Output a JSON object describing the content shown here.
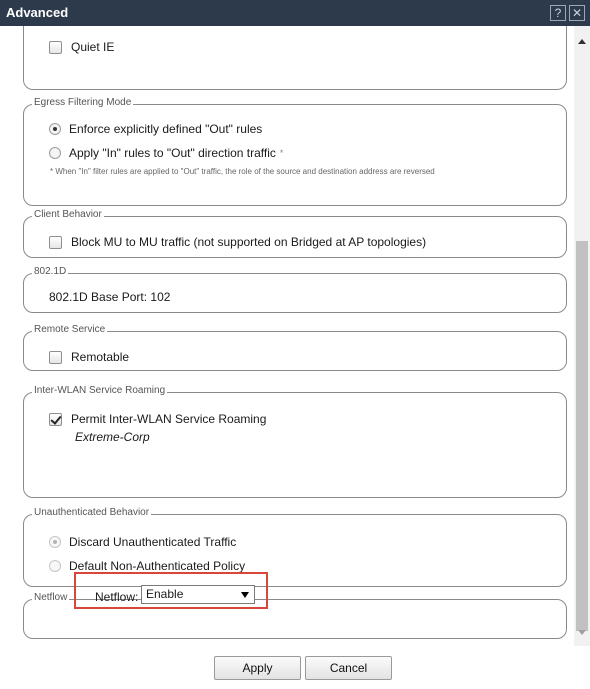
{
  "window": {
    "title": "Advanced",
    "help_glyph": "?",
    "close_glyph": "✕"
  },
  "quiet_ie": {
    "label": "Quiet IE",
    "checked": false
  },
  "egress": {
    "legend": "Egress Filtering Mode",
    "option1": "Enforce explicitly defined \"Out\" rules",
    "option2": "Apply \"In\" rules to \"Out\" direction traffic",
    "asterisk": "*",
    "note": "* When \"In\" filter rules are applied to \"Out\" traffic, the role of the source and destination address are reversed",
    "selected": 1
  },
  "client": {
    "legend": "Client Behavior",
    "label": "Block MU to MU traffic (not supported on Bridged at AP topologies)",
    "checked": false
  },
  "dot1d": {
    "legend": "802.1D",
    "text": "802.1D Base Port: 102"
  },
  "remote": {
    "legend": "Remote Service",
    "label": "Remotable",
    "checked": false
  },
  "roaming": {
    "legend": "Inter-WLAN Service Roaming",
    "label": "Permit Inter-WLAN Service Roaming",
    "checked": true,
    "service": "Extreme-Corp"
  },
  "unauth": {
    "legend": "Unauthenticated Behavior",
    "option1": "Discard Unauthenticated Traffic",
    "option2": "Default Non-Authenticated Policy",
    "selected": 1
  },
  "netflow": {
    "legend": "Netflow",
    "label": "Netflow:",
    "value": "Enable"
  },
  "buttons": {
    "apply": "Apply",
    "cancel": "Cancel"
  },
  "colors": {
    "titlebar": "#2c3a4c",
    "highlight": "#d9463b"
  }
}
